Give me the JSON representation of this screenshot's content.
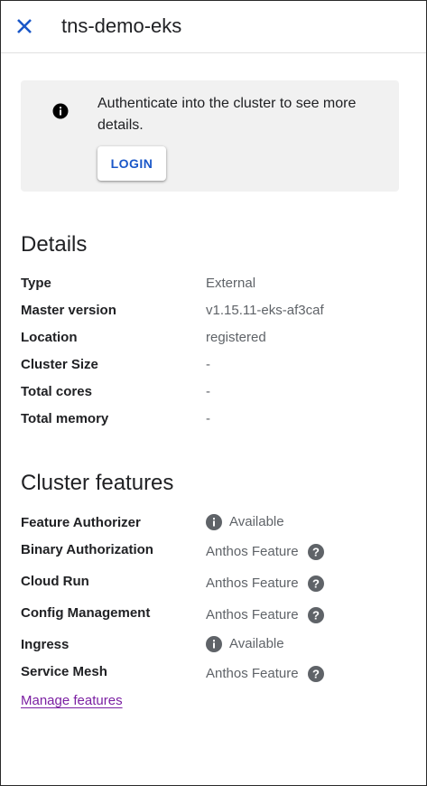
{
  "header": {
    "title": "tns-demo-eks"
  },
  "banner": {
    "message": "Authenticate into the cluster to see more details.",
    "login_label": "LOGIN"
  },
  "details": {
    "heading": "Details",
    "rows": [
      {
        "label": "Type",
        "value": "External"
      },
      {
        "label": "Master version",
        "value": "v1.15.11-eks-af3caf"
      },
      {
        "label": "Location",
        "value": "registered"
      },
      {
        "label": "Cluster Size",
        "value": "-"
      },
      {
        "label": "Total cores",
        "value": "-"
      },
      {
        "label": "Total memory",
        "value": "-"
      }
    ]
  },
  "features": {
    "heading": "Cluster features",
    "rows": [
      {
        "label": "Feature Authorizer",
        "value": "Available",
        "icon": "info-icon"
      },
      {
        "label": "Binary Authorization",
        "value": "Anthos Feature",
        "icon": "help-icon"
      },
      {
        "label": "Cloud Run",
        "value": "Anthos Feature",
        "icon": "help-icon"
      },
      {
        "label": "Config Management",
        "value": "Anthos Feature",
        "icon": "help-icon"
      },
      {
        "label": "Ingress",
        "value": "Available",
        "icon": "info-icon"
      },
      {
        "label": "Service Mesh",
        "value": "Anthos Feature",
        "icon": "help-icon"
      }
    ],
    "manage_link": "Manage features"
  },
  "colors": {
    "accent_blue": "#1a57c8",
    "link_purple": "#7b1fa2",
    "banner_bg": "#f1f1f1",
    "secondary_text": "#5f6368"
  }
}
